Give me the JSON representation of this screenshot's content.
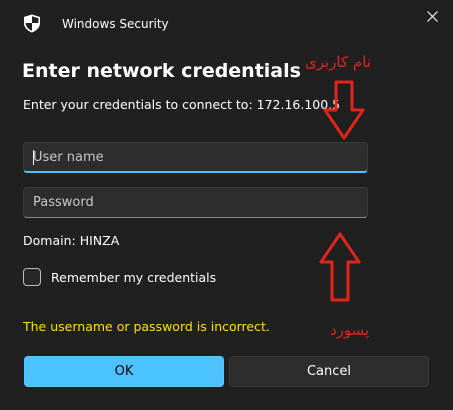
{
  "window": {
    "app_title": "Windows Security",
    "close_icon": "close-icon",
    "app_icon": "shield-icon"
  },
  "dialog": {
    "heading": "Enter network credentials",
    "prompt": "Enter your credentials to connect to: 172.16.100.5",
    "username": {
      "value": "",
      "placeholder": "User name"
    },
    "password": {
      "value": "",
      "placeholder": "Password"
    },
    "domain": "Domain: HINZA",
    "remember_label": "Remember my credentials",
    "remember_checked": false,
    "error": "The username or password is incorrect.",
    "ok_label": "OK",
    "cancel_label": "Cancel"
  },
  "annotations": {
    "username_note": "نام کاربری",
    "password_note": "پسورد",
    "color": "#e1251b"
  },
  "colors": {
    "background": "#202020",
    "accent": "#4cc2ff",
    "error": "#fce100"
  }
}
